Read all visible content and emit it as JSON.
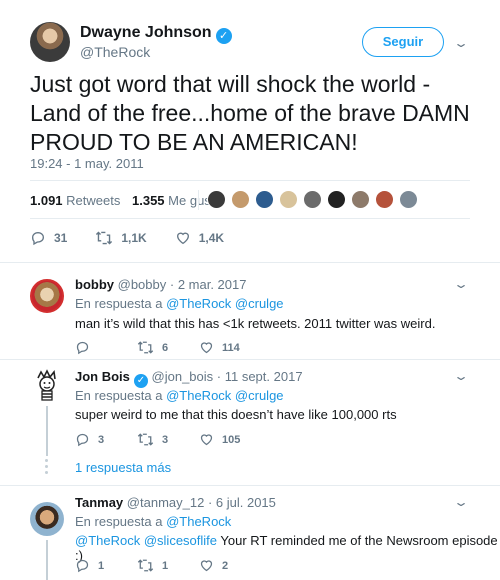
{
  "main_tweet": {
    "author_name": "Dwayne Johnson",
    "author_handle": "@TheRock",
    "follow_label": "Seguir",
    "text": "Just got word that will shock the world - Land of the free...home of the brave DAMN PROUD TO BE AN AMERICAN!",
    "timestamp": "19:24 - 1 may. 2011",
    "retweets_count": "1.091",
    "retweets_label": "Retweets",
    "likes_count": "1.355",
    "likes_label": "Me gusta",
    "actions": {
      "replies": "31",
      "retweets": "1,1K",
      "likes": "1,4K"
    }
  },
  "replies": [
    {
      "name": "bobby",
      "handle": "@bobby",
      "date": "· 2 mar. 2017",
      "in_reply_prefix": "En respuesta a",
      "mention_1": "@TheRock",
      "mention_2": "@crulge",
      "text": "man it’s wild that this has <1k retweets. 2011 twitter was weird.",
      "replies": "",
      "retweets": "6",
      "likes": "114"
    },
    {
      "name": "Jon Bois",
      "handle": "@jon_bois",
      "date": "· 11 sept. 2017",
      "in_reply_prefix": "En respuesta a",
      "mention_1": "@TheRock",
      "mention_2": "@crulge",
      "text": "super weird to me that this doesn’t have like 100,000 rts",
      "replies": "3",
      "retweets": "3",
      "likes": "105",
      "more_replies": "1 respuesta más"
    },
    {
      "name": "Tanmay",
      "handle": "@tanmay_12",
      "date": "· 6 jul. 2015",
      "in_reply_prefix": "En respuesta a",
      "mention_1": "@TheRock",
      "text_mention_1": "@TheRock",
      "text_mention_2": "@slicesoflife",
      "text": "Your RT reminded me of the Newsroom episode :)",
      "replies": "1",
      "retweets": "1",
      "likes": "2"
    }
  ],
  "colors": {
    "accent": "#1da1f2",
    "link": "#1b95e0",
    "muted": "#657786",
    "text": "#14171a",
    "divider": "#e6ecf0"
  }
}
